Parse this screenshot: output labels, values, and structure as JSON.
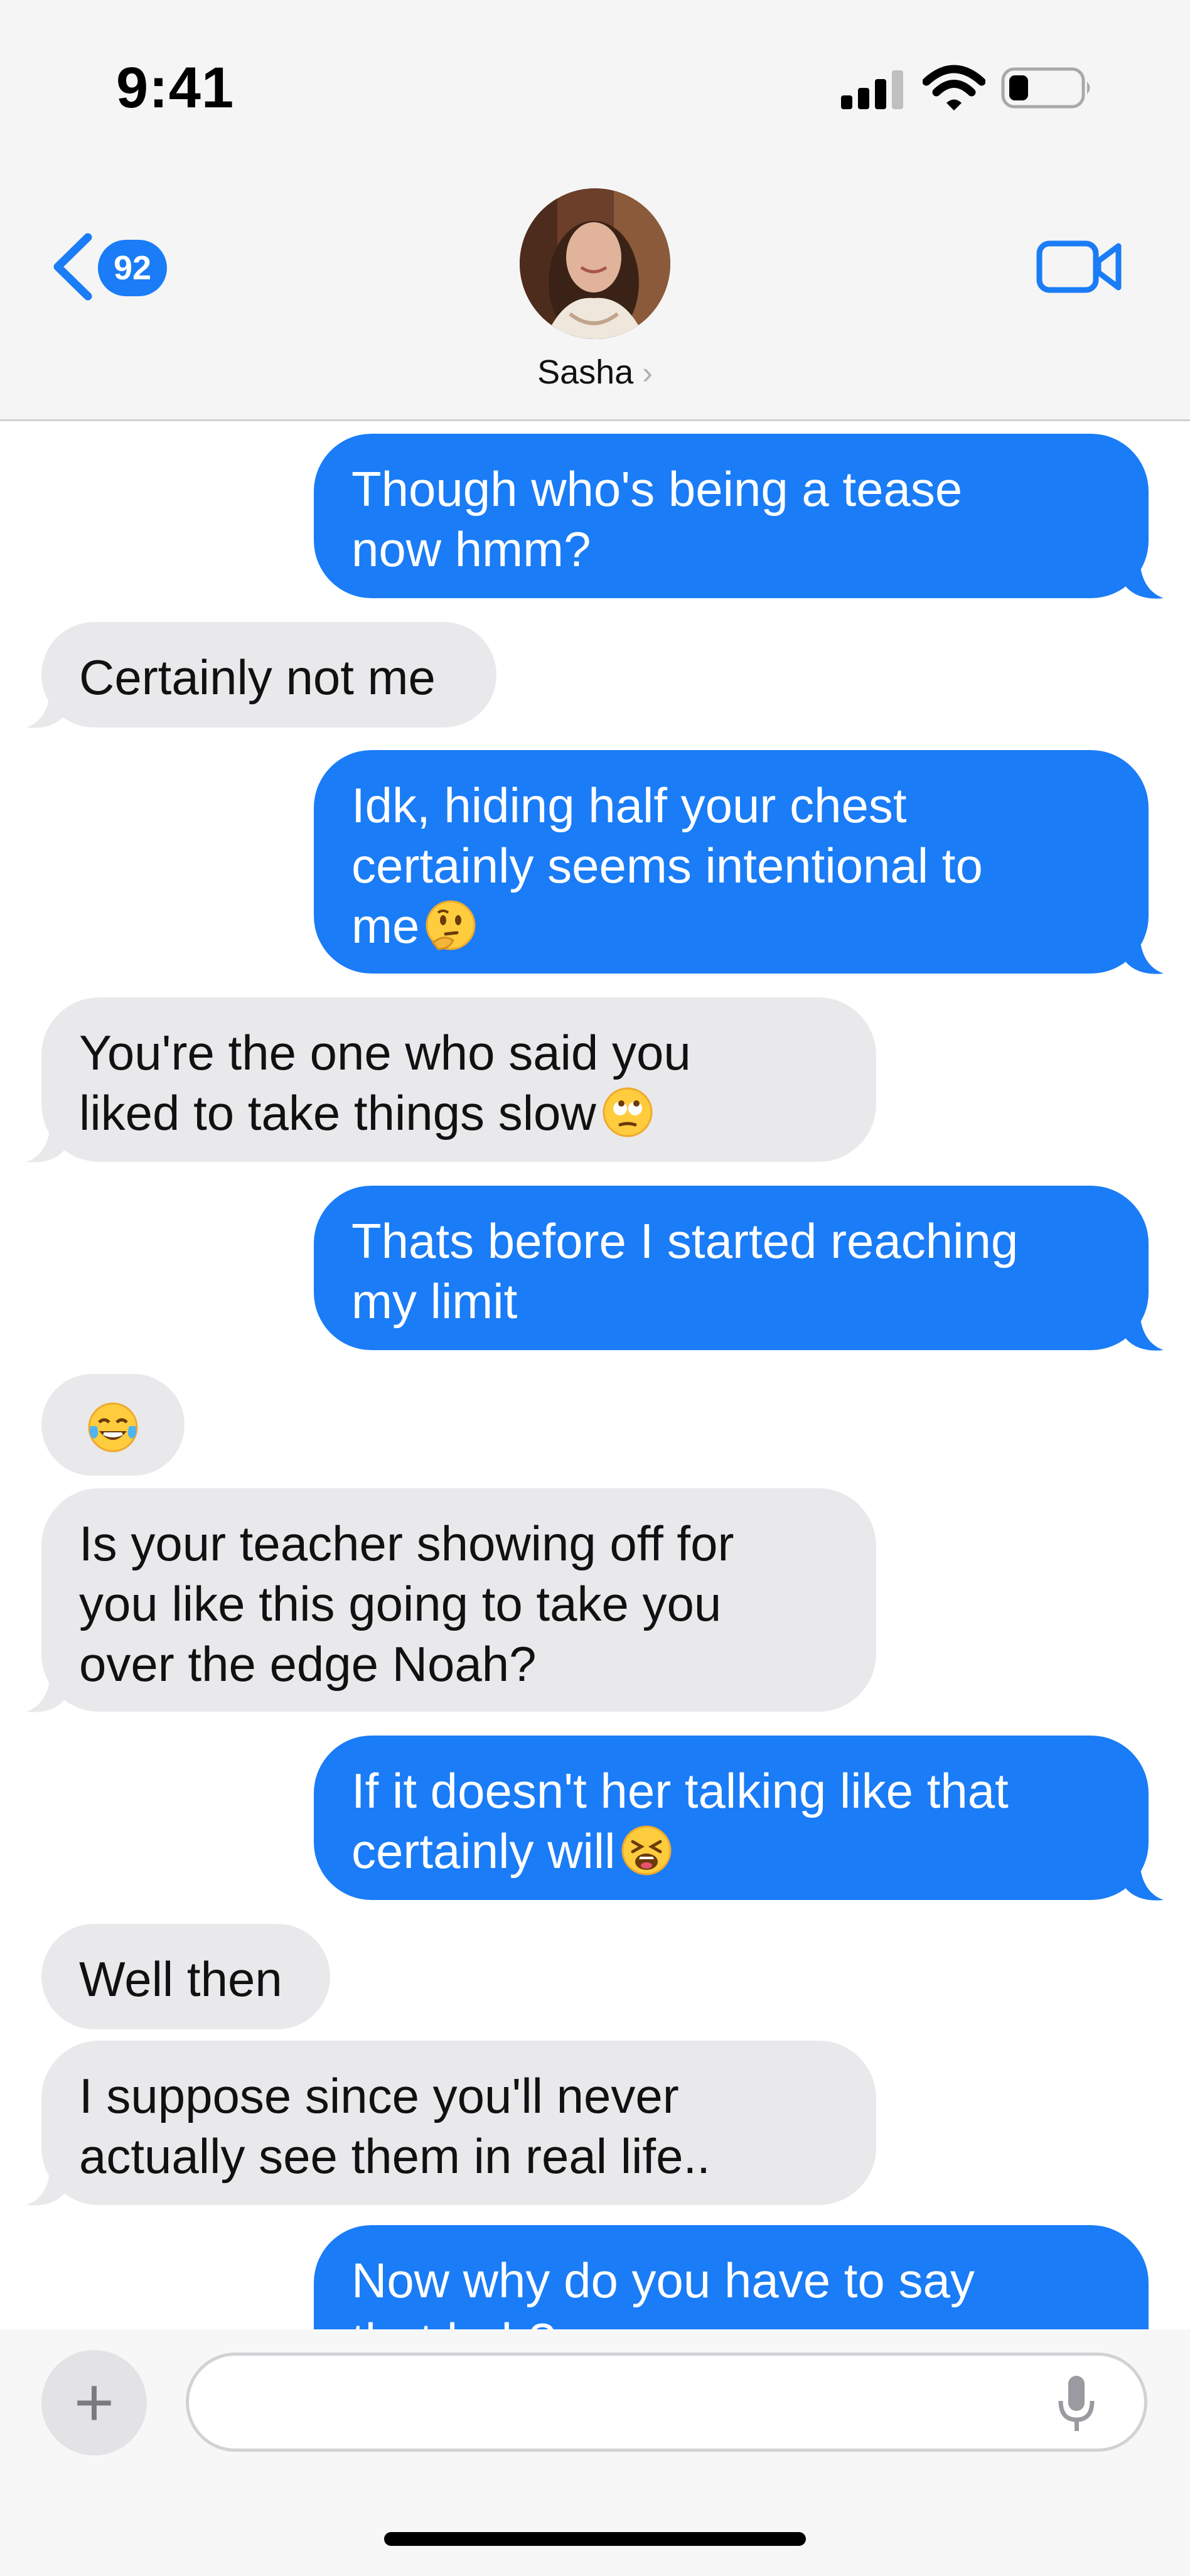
{
  "status_bar": {
    "time": "9:41",
    "icons": [
      "cellular-signal-icon",
      "wifi-icon",
      "battery-icon"
    ]
  },
  "header": {
    "back_badge": "92",
    "contact_name": "Sasha",
    "name_chevron": "›",
    "icons": [
      "chevron-left-icon",
      "video-camera-icon"
    ]
  },
  "colors": {
    "outgoing_bubble": "#1a7cf6",
    "incoming_bubble": "#e9e9eb",
    "accent": "#1a7cf6"
  },
  "messages": [
    {
      "direction": "out",
      "lines": [
        "Though who's being a tease",
        "now hmm?"
      ]
    },
    {
      "direction": "in",
      "lines": [
        "Certainly not me"
      ]
    },
    {
      "direction": "out",
      "lines": [
        "Idk, hiding half your chest",
        "certainly seems intentional to",
        "me"
      ],
      "emoji": "thinking-face-emoji"
    },
    {
      "direction": "in",
      "lines": [
        "You're the one who said you",
        "liked to take things slow"
      ],
      "emoji": "face-with-rolling-eyes-emoji"
    },
    {
      "direction": "out",
      "lines": [
        "Thats before I started reaching",
        "my limit"
      ]
    },
    {
      "direction": "in",
      "lines": [],
      "emoji": "face-with-tears-of-joy-emoji"
    },
    {
      "direction": "in",
      "lines": [
        "Is your teacher showing off for",
        "you like this going to take you",
        "over the edge Noah?"
      ]
    },
    {
      "direction": "out",
      "lines": [
        "If it doesn't her talking like that",
        "certainly will"
      ],
      "emoji": "tired-face-emoji"
    },
    {
      "direction": "in",
      "lines": [
        "Well then"
      ]
    },
    {
      "direction": "in",
      "lines": [
        "I suppose since you'll never",
        "actually see them in real life.."
      ]
    },
    {
      "direction": "out",
      "lines": [
        "Now why do you have to say",
        "that huh?"
      ]
    }
  ],
  "composer": {
    "plus_label": "+",
    "input_value": "",
    "input_placeholder": "",
    "icons": [
      "plus-icon",
      "microphone-icon"
    ]
  }
}
